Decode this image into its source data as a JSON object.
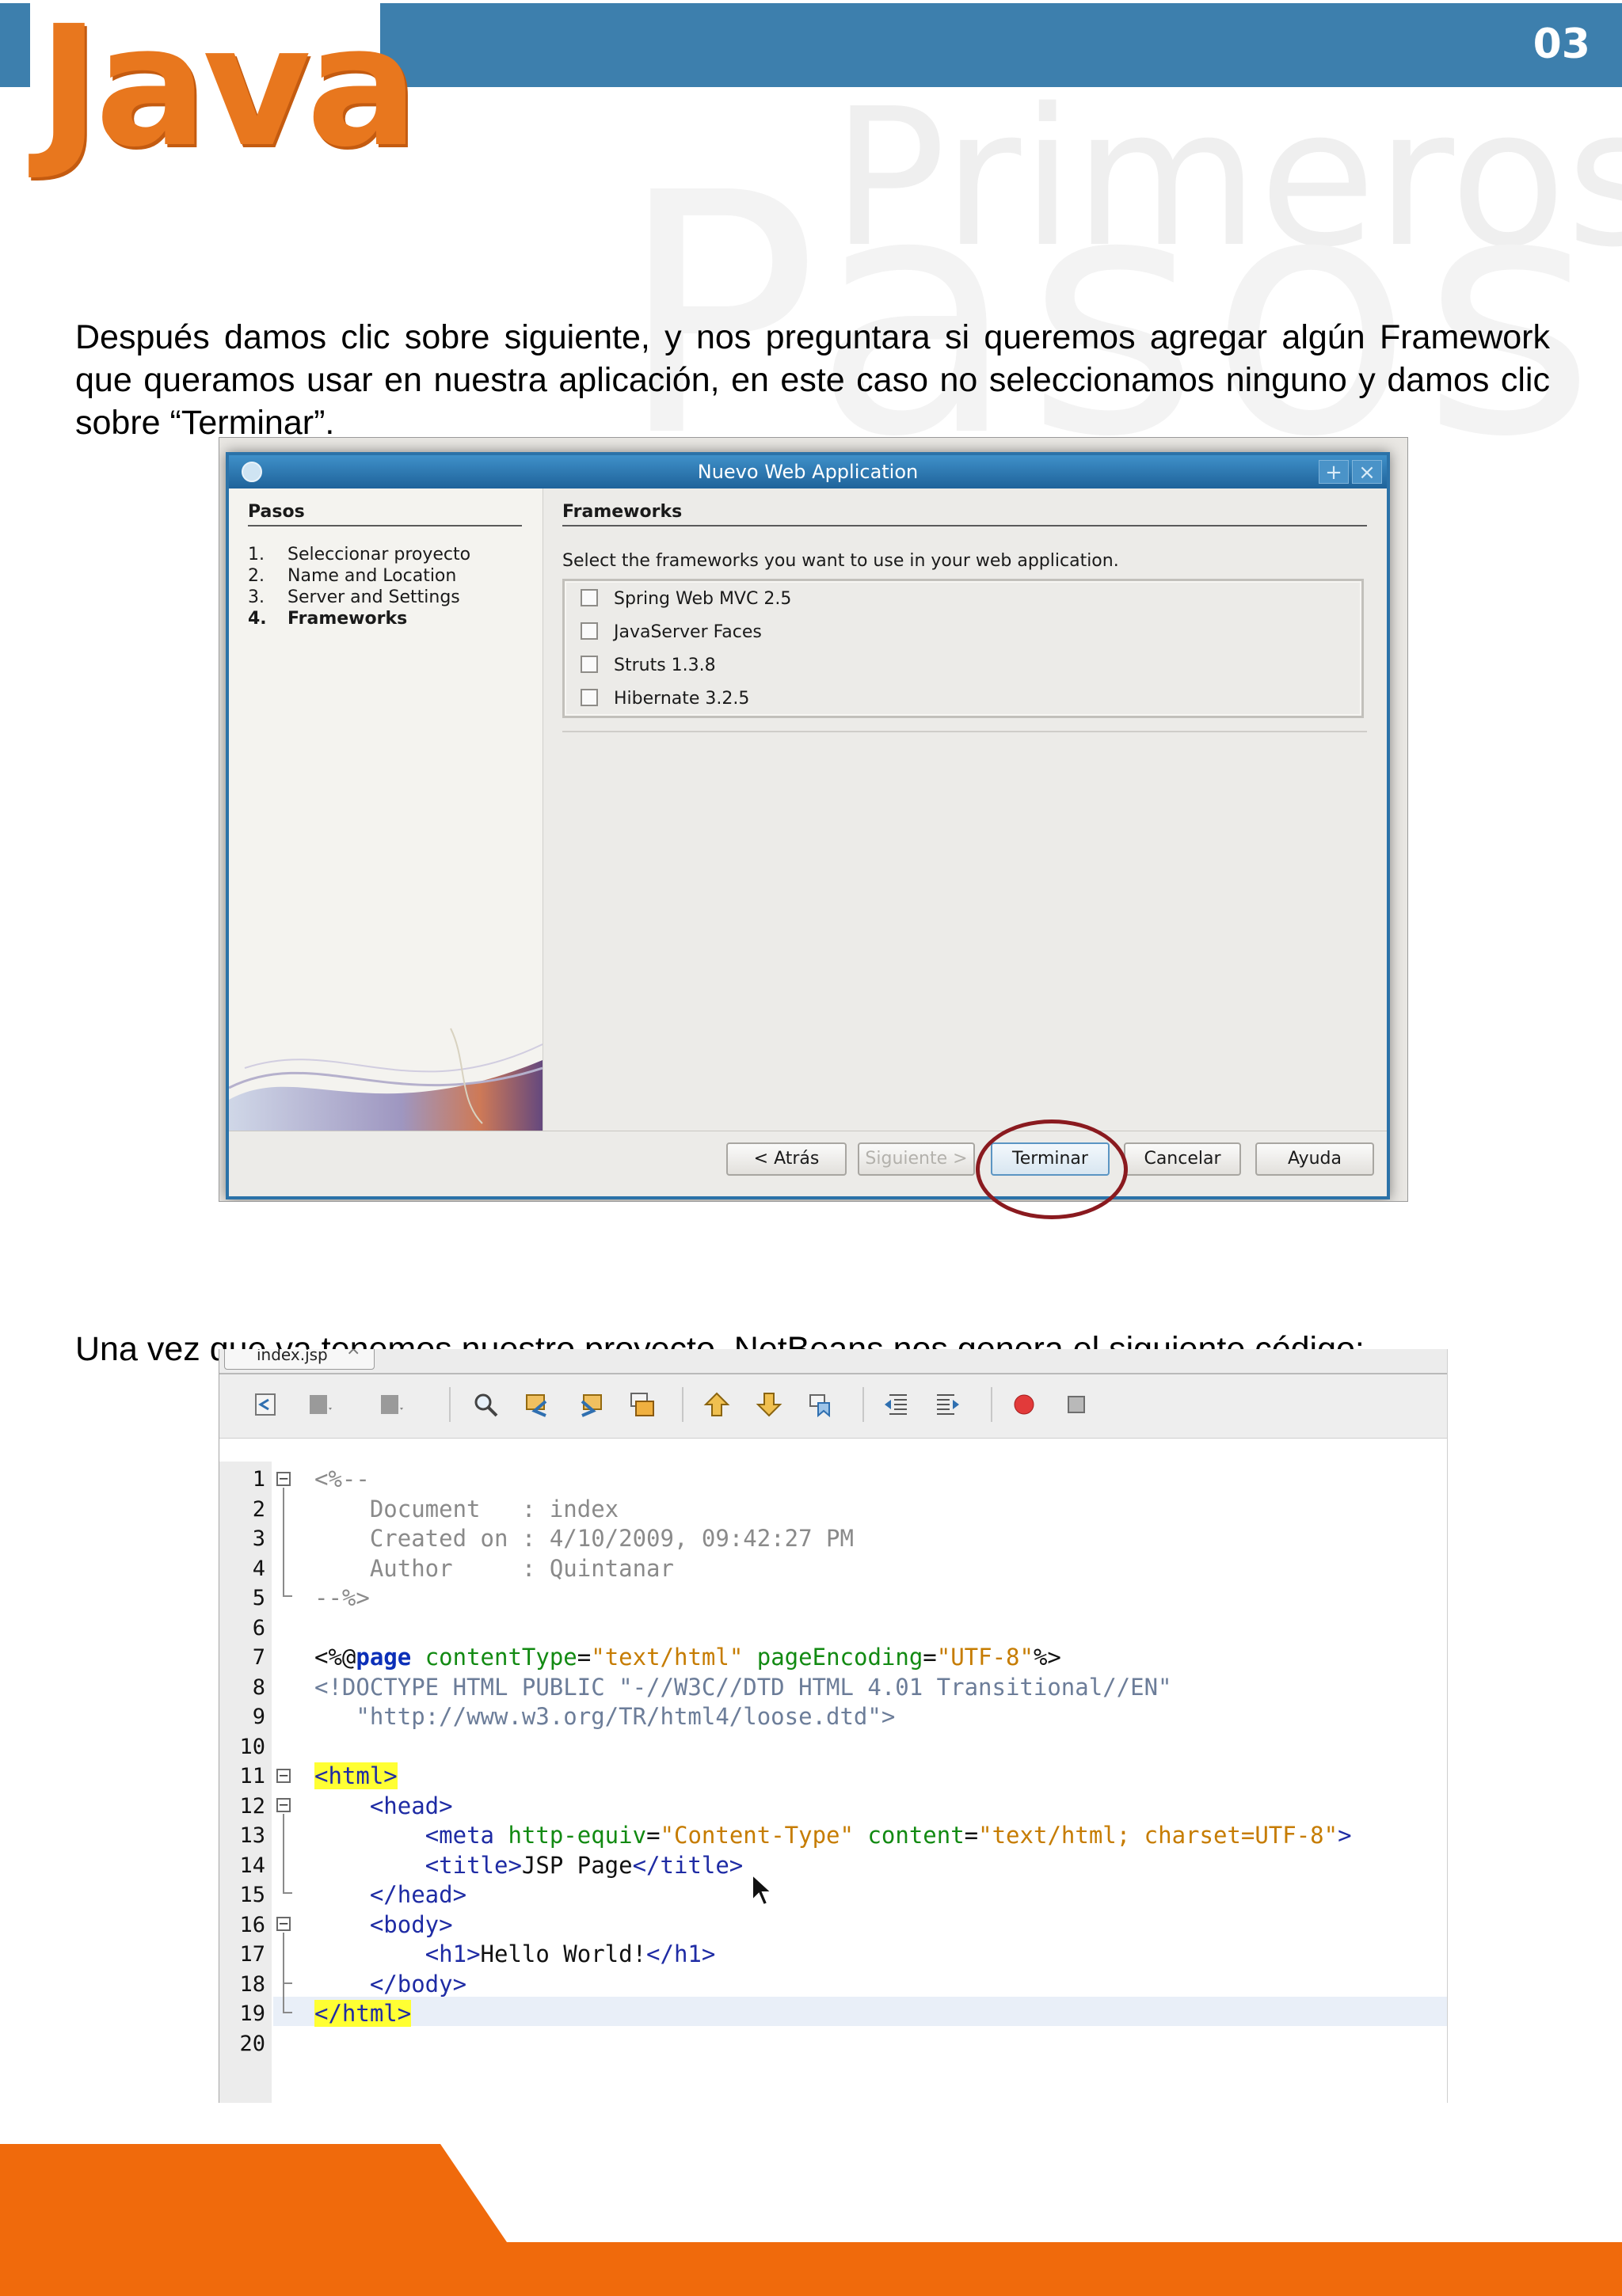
{
  "header": {
    "logo_text": "Java",
    "page_number": "03",
    "watermark_line1": "Primeros",
    "watermark_line2": "Pasos"
  },
  "paragraphs": {
    "p1": "Después damos clic sobre siguiente, y nos preguntara si queremos agregar algún Framework que queramos usar en nuestra aplicación, en este caso no seleccionamos ninguno y damos clic sobre “Terminar”.",
    "p2": "Una vez que ya tenemos nuestro proyecto, NetBeans nos genera el siguiente código:"
  },
  "dialog": {
    "title": "Nuevo  Web Application",
    "steps_heading": "Pasos",
    "steps": [
      {
        "num": "1.",
        "label": "Seleccionar proyecto"
      },
      {
        "num": "2.",
        "label": "Name and Location"
      },
      {
        "num": "3.",
        "label": "Server and Settings"
      },
      {
        "num": "4.",
        "label": "Frameworks"
      }
    ],
    "content_heading": "Frameworks",
    "instruction": "Select the frameworks you want to use in your web application.",
    "frameworks": [
      {
        "label": "Spring Web MVC 2.5",
        "checked": false
      },
      {
        "label": "JavaServer Faces",
        "checked": false
      },
      {
        "label": "Struts 1.3.8",
        "checked": false
      },
      {
        "label": "Hibernate 3.2.5",
        "checked": false
      }
    ],
    "buttons": {
      "back": "< Atrás",
      "next": "Siguiente >",
      "finish": "Terminar",
      "cancel": "Cancelar",
      "help": "Ayuda"
    }
  },
  "editor": {
    "file_tab": "index.jsp",
    "line_numbers": [
      "1",
      "2",
      "3",
      "4",
      "5",
      "6",
      "7",
      "8",
      "9",
      "10",
      "11",
      "12",
      "13",
      "14",
      "15",
      "16",
      "17",
      "18",
      "19",
      "20"
    ],
    "code": {
      "l1": "<%--",
      "l2_key": "Document   ",
      "l2_val": ": index",
      "l3_key": "Created on ",
      "l3_val": ": 4/10/2009, 09:42:27 PM",
      "l4_key": "Author     ",
      "l4_val": ": Quintanar",
      "l5": "--%>",
      "l7_open": "<%@",
      "l7_kw": "page",
      "l7_a1": "contentType",
      "l7_v1": "\"text/html\"",
      "l7_a2": "pageEncoding",
      "l7_v2": "\"UTF-8\"",
      "l7_close": "%>",
      "l8": "<!DOCTYPE HTML PUBLIC \"-//W3C//DTD HTML 4.01 Transitional//EN\"",
      "l9": "\"http://www.w3.org/TR/html4/loose.dtd\">",
      "l11": "<html>",
      "l12": "<head>",
      "l13_tag": "<meta",
      "l13_a1": "http-equiv",
      "l13_v1": "\"Content-Type\"",
      "l13_a2": "content",
      "l13_v2": "\"text/html; charset=UTF-8\"",
      "l13_close": ">",
      "l14_open": "<title>",
      "l14_text": "JSP Page",
      "l14_close": "</title>",
      "l15": "</head>",
      "l16": "<body>",
      "l17_open": "<h1>",
      "l17_text": "Hello World!",
      "l17_close": "</h1>",
      "l18": "</body>",
      "l19": "</html>"
    }
  },
  "colors": {
    "header_blue": "#3d7fad",
    "java_orange": "#e8771e",
    "footer_orange": "#f06a0c",
    "highlight_ring": "#8a1a1f"
  }
}
